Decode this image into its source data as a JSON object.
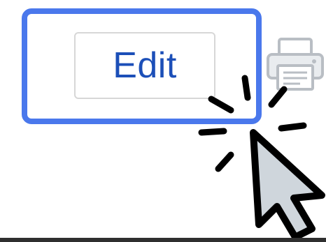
{
  "toolbar": {
    "edit_label": "Edit"
  },
  "icons": {
    "printer": "printer-icon",
    "cursor": "mouse-pointer-icon",
    "click": "click-burst-icon"
  },
  "colors": {
    "highlight": "#4a78ec",
    "edit_text": "#1c4fb8",
    "button_border": "#d7d7d7",
    "cursor_fill": "#cfd6dc"
  }
}
